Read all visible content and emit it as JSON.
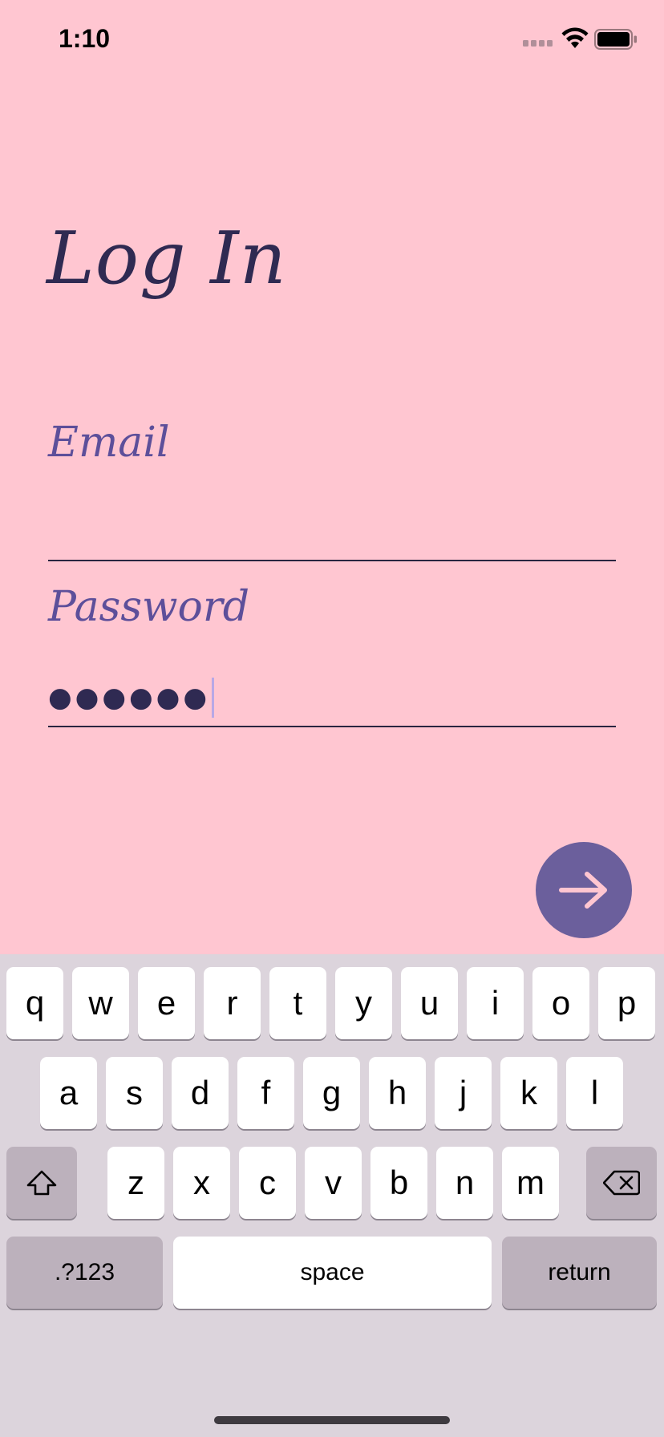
{
  "status_bar": {
    "time": "1:10"
  },
  "login": {
    "title": "Log In",
    "email_label": "Email",
    "email_value": "",
    "password_label": "Password",
    "password_mask": "●●●●●●"
  },
  "keyboard": {
    "row1": [
      "q",
      "w",
      "e",
      "r",
      "t",
      "y",
      "u",
      "i",
      "o",
      "p"
    ],
    "row2": [
      "a",
      "s",
      "d",
      "f",
      "g",
      "h",
      "j",
      "k",
      "l"
    ],
    "row3": [
      "z",
      "x",
      "c",
      "v",
      "b",
      "n",
      "m"
    ],
    "numbers_label": ".?123",
    "space_label": "space",
    "return_label": "return"
  },
  "colors": {
    "background": "#ffc6d1",
    "accent": "#6b5f9c",
    "title_text": "#2f2a52",
    "label_text": "#5d4f9a",
    "keyboard_bg": "#dcd4dc"
  },
  "icons": {
    "submit": "arrow-right-icon",
    "shift": "shift-icon",
    "delete": "backspace-icon"
  }
}
